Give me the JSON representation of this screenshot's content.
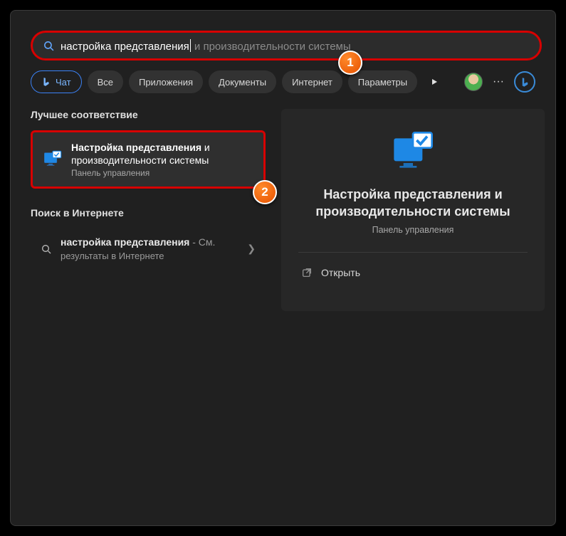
{
  "search": {
    "typed": "настройка представления",
    "ghost": " и производительности системы"
  },
  "filters": {
    "chat": "Чат",
    "all": "Все",
    "apps": "Приложения",
    "docs": "Документы",
    "web": "Интернет",
    "settings": "Параметры"
  },
  "left": {
    "best_header": "Лучшее соответствие",
    "best": {
      "line1": "Настройка представления",
      "line1_suffix": " и",
      "line2": "производительности системы",
      "sub": "Панель управления"
    },
    "web_header": "Поиск в Интернете",
    "web_item": {
      "prefix": "настройка представления",
      "suffix": " - См.",
      "sub": "результаты в Интернете"
    }
  },
  "preview": {
    "title": "Настройка представления и производительности системы",
    "sub": "Панель управления",
    "open": "Открыть"
  },
  "callouts": {
    "one": "1",
    "two": "2"
  }
}
